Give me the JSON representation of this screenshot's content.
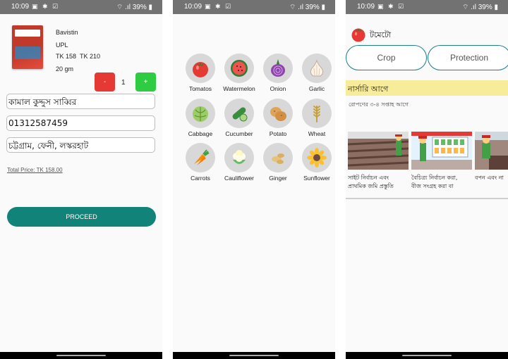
{
  "status": {
    "time": "10:09",
    "battery": "39%"
  },
  "cart": {
    "product_name": "Bavistin",
    "brand": "UPL",
    "price": "TK 158",
    "mrp": "TK 210",
    "size": "20 gm",
    "minus_label": "-",
    "quantity": "1",
    "plus_label": "+",
    "name_value": "কামাল কুদ্দুস সাব্বির",
    "phone_value": "01312587459",
    "address_value": "চট্টগ্রাম, ফেনী, লস্করহাট",
    "total_price": "Total Price: TK 158.00",
    "proceed_label": "PROCEED"
  },
  "crops": {
    "items": [
      {
        "label": "Tomatos",
        "icon": "tomato-icon"
      },
      {
        "label": "Watermelon",
        "icon": "watermelon-icon"
      },
      {
        "label": "Onion",
        "icon": "onion-icon"
      },
      {
        "label": "Garlic",
        "icon": "garlic-icon"
      },
      {
        "label": "Cabbage",
        "icon": "cabbage-icon"
      },
      {
        "label": "Cucumber",
        "icon": "cucumber-icon"
      },
      {
        "label": "Potato",
        "icon": "potato-icon"
      },
      {
        "label": "Wheat",
        "icon": "wheat-icon"
      },
      {
        "label": "Carrots",
        "icon": "carrot-icon"
      },
      {
        "label": "Cauliflower",
        "icon": "cauliflower-icon"
      },
      {
        "label": "Ginger",
        "icon": "ginger-icon"
      },
      {
        "label": "Sunflower",
        "icon": "sunflower-icon"
      }
    ]
  },
  "detail": {
    "title": "টমেটো",
    "tabs": [
      "Crop",
      "Protection"
    ],
    "section": "নার্সারি আগে",
    "subtitle": "রোপণের ৩-৪ সপ্তাহ আগে",
    "cards": [
      {
        "line1": "সাইট নির্বাচন এবং",
        "line2": "প্রাথমিক জমি প্রস্তুতি"
      },
      {
        "line1": "বৈচিত্র্য নির্বাচন করা,",
        "line2": "বীজ সংগ্রহ করা বা"
      },
      {
        "line1": "বপন এবং না",
        "line2": ""
      }
    ]
  },
  "colors": {
    "teal": "#118379",
    "red": "#e53935",
    "green": "#2ecc40",
    "banner": "#f7ec9a"
  }
}
